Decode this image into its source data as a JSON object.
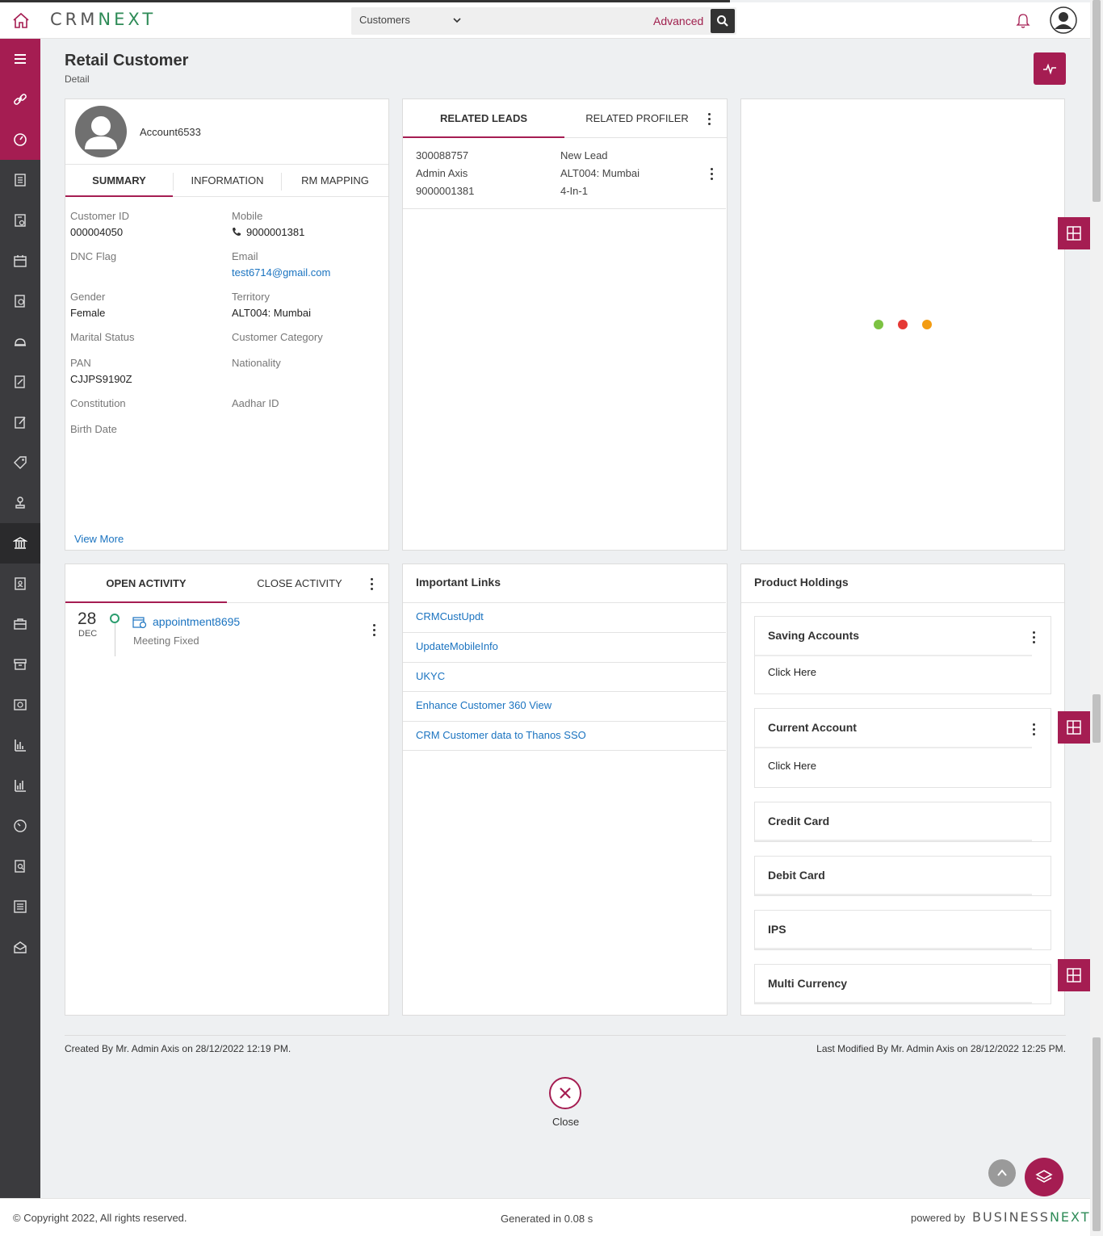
{
  "header": {
    "logo_crm": "CRM",
    "logo_next": "NEXT",
    "search_entity": "Customers",
    "search_placeholder": "",
    "advanced_label": "Advanced"
  },
  "page": {
    "title": "Retail Customer",
    "subtitle": "Detail"
  },
  "profile": {
    "name": "Account6533",
    "tabs": [
      "SUMMARY",
      "INFORMATION",
      "RM MAPPING"
    ],
    "fields": {
      "customer_id_label": "Customer ID",
      "customer_id": "000004050",
      "mobile_label": "Mobile",
      "mobile": "9000001381",
      "dnc_label": "DNC Flag",
      "email_label": "Email",
      "email": "test6714@gmail.com",
      "gender_label": "Gender",
      "gender": "Female",
      "territory_label": "Territory",
      "territory": "ALT004: Mumbai",
      "marital_label": "Marital Status",
      "category_label": "Customer Category",
      "pan_label": "PAN",
      "pan": "CJJPS9190Z",
      "nationality_label": "Nationality",
      "constitution_label": "Constitution",
      "aadhar_label": "Aadhar ID",
      "birth_label": "Birth Date"
    },
    "view_more": "View More"
  },
  "related": {
    "tabs": [
      "RELATED LEADS",
      "RELATED PROFILER"
    ],
    "lead": {
      "id": "300088757",
      "status": "New Lead",
      "owner": "Admin Axis",
      "territory": "ALT004: Mumbai",
      "phone": "9000001381",
      "product": "4-In-1"
    }
  },
  "activity": {
    "tabs": [
      "OPEN ACTIVITY",
      "CLOSE ACTIVITY"
    ],
    "item": {
      "day": "28",
      "month": "DEC",
      "title": "appointment8695",
      "status": "Meeting Fixed"
    }
  },
  "links": {
    "title": "Important Links",
    "items": [
      "CRMCustUpdt",
      "UpdateMobileInfo",
      "UKYC",
      "Enhance Customer 360 View",
      "CRM Customer data to Thanos SSO"
    ]
  },
  "holdings": {
    "title": "Product Holdings",
    "saving": {
      "title": "Saving Accounts",
      "action": "Click Here"
    },
    "current": {
      "title": "Current Account",
      "action": "Click Here"
    },
    "others": [
      "Credit Card",
      "Debit Card",
      "IPS",
      "Multi Currency"
    ]
  },
  "footer": {
    "created": "Created By Mr. Admin Axis on 28/12/2022 12:19 PM.",
    "modified": "Last Modified By Mr. Admin Axis on 28/12/2022 12:25 PM.",
    "close": "Close",
    "copyright": "© Copyright 2022, All rights reserved.",
    "generated": "Generated in 0.08 s",
    "powered": "powered by",
    "brand_business": "BUSINESS",
    "brand_next": "NEXT"
  },
  "colors": {
    "brand": "#a51d52",
    "sidebar": "#3b3b3e",
    "link": "#1a73c0",
    "loader_green": "#7cc242",
    "loader_red": "#e53935",
    "loader_orange": "#f39c12"
  }
}
